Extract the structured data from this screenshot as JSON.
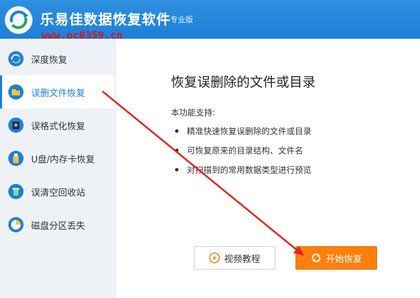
{
  "app": {
    "title": "乐易佳数据恢复软件",
    "edition": "专业版",
    "watermark": "www.pc0359.cn"
  },
  "sidebar": {
    "items": [
      {
        "label": "深度恢复",
        "icon": "deep-recover-icon",
        "active": false
      },
      {
        "label": "误删文件恢复",
        "icon": "folder-icon",
        "active": true
      },
      {
        "label": "误格式化恢复",
        "icon": "disk-icon",
        "active": false
      },
      {
        "label": "U盘/内存卡恢复",
        "icon": "usb-icon",
        "active": false
      },
      {
        "label": "误清空回收站",
        "icon": "recycle-bin-icon",
        "active": false
      },
      {
        "label": "磁盘分区丢失",
        "icon": "partition-icon",
        "active": false
      }
    ]
  },
  "content": {
    "title": "恢复误删除的文件或目录",
    "support_label": "本功能支持:",
    "features": [
      "精准快速恢复误删除的文件或目录",
      "可恢复原来的目录结构、文件名",
      "对扫描到的常用数据类型进行预览"
    ]
  },
  "buttons": {
    "video_label": "视频教程",
    "start_label": "开始恢复"
  },
  "colors": {
    "accent": "#1d7fd8",
    "start_button": "#ff7f0e",
    "annotation_arrow": "#e8231b"
  }
}
